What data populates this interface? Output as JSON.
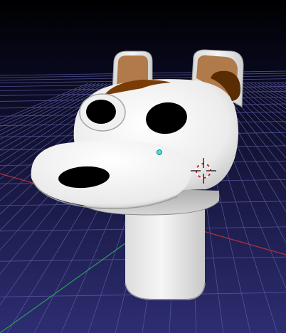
{
  "viewport": {
    "background_top": "#000000",
    "background_bottom": "#2a2a6e",
    "grid_color": "#5a5aa0",
    "x_axis_color": "#c0303a",
    "y_axis_color": "#3aa060",
    "selection_dot_color": "#40e0e0"
  },
  "model": {
    "body_color": "#f4f4f4",
    "patch_color": "#7a3c06",
    "inner_ear_color": "#b07a4a",
    "eye_color": "#000000"
  },
  "widgets": {
    "cursor_3d": "3d-cursor",
    "object_origin": "object-origin"
  }
}
